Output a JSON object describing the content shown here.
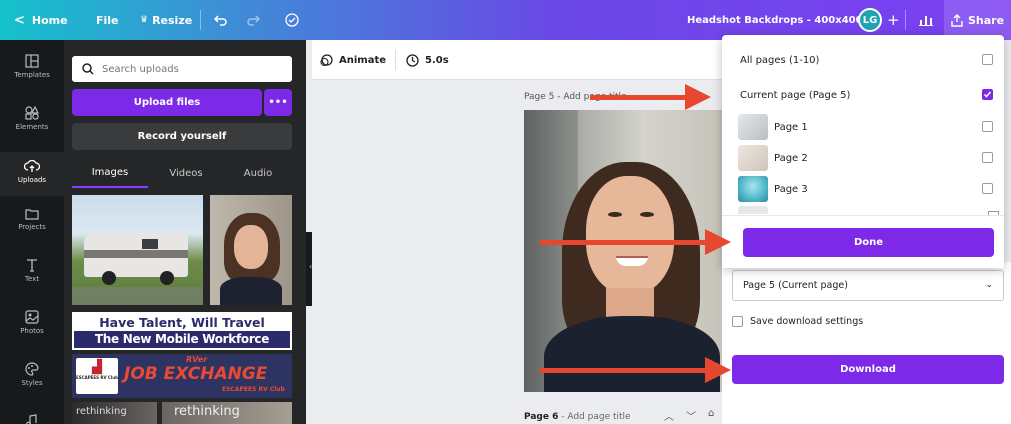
{
  "topbar": {
    "home_label": "Home",
    "file_label": "File",
    "resize_label": "Resize",
    "doc_title": "Headshot Backdrops - 400x400",
    "avatar_initials": "LG",
    "share_label": "Share"
  },
  "sidebar": {
    "items": [
      {
        "label": "Templates",
        "icon": "templates-icon"
      },
      {
        "label": "Elements",
        "icon": "elements-icon"
      },
      {
        "label": "Uploads",
        "icon": "uploads-icon"
      },
      {
        "label": "Projects",
        "icon": "folder-icon"
      },
      {
        "label": "Text",
        "icon": "text-icon"
      },
      {
        "label": "Photos",
        "icon": "photos-icon"
      },
      {
        "label": "Styles",
        "icon": "palette-icon"
      }
    ]
  },
  "panel": {
    "search_placeholder": "Search uploads",
    "upload_label": "Upload files",
    "more_label": "•••",
    "record_label": "Record yourself",
    "tabs": [
      "Images",
      "Videos",
      "Audio"
    ],
    "banner1": {
      "line1": "Have Talent, Will Travel",
      "line2": "The New Mobile Workforce"
    },
    "banner2": {
      "logo_text": "ESCAPEES RV Club",
      "rver": "RVer",
      "title": "JOB EXCHANGE",
      "sub": "ESCAPEES RV Club"
    },
    "thumb_text": "rethinking"
  },
  "toolbar": {
    "animate_label": "Animate",
    "duration_label": "5.0s"
  },
  "canvas": {
    "page5_label": "Page 5 - Add page title",
    "page6_label": "Page 6",
    "page6_title": " - Add page title"
  },
  "dropdown": {
    "all_pages": "All pages (1-10)",
    "current_page": "Current page (Page 5)",
    "pages": [
      "Page 1",
      "Page 2",
      "Page 3"
    ],
    "done_label": "Done"
  },
  "download": {
    "select_value": "Page 5 (Current page)",
    "save_settings": "Save download settings",
    "download_label": "Download"
  },
  "colors": {
    "accent": "#7d2ae8",
    "arrow": "#e8472f"
  }
}
